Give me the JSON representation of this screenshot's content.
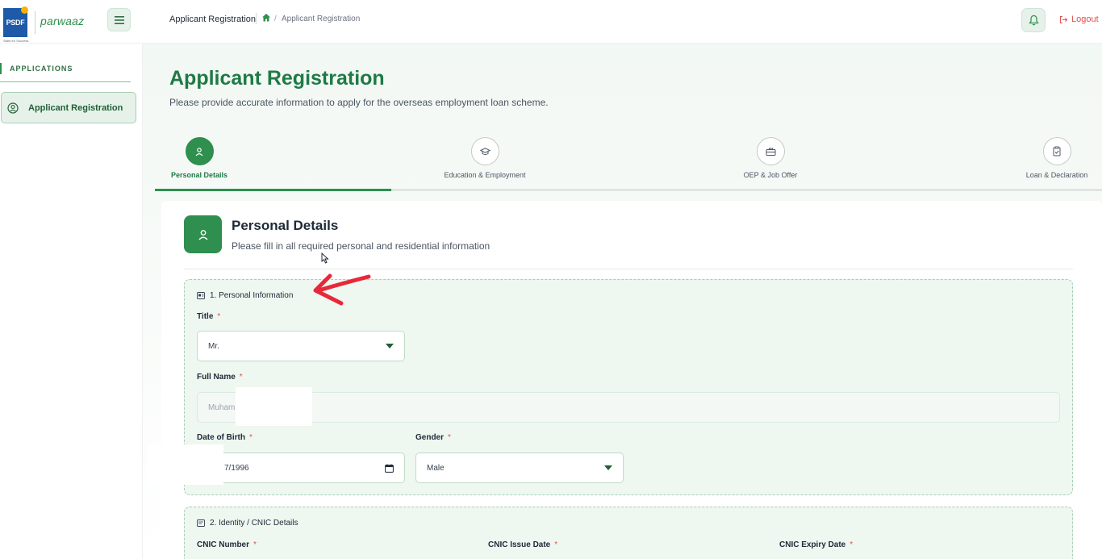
{
  "brand": {
    "logo_mark": "PSDF",
    "logo_text": "parwaaz",
    "logo_tagline": "Skills for Success",
    "primary_color": "#2f8f4e",
    "accent_color": "#1f7a45"
  },
  "header": {
    "breadcrumb_title": "Applicant Registration",
    "breadcrumb_current": "Applicant Registration",
    "breadcrumb_separator": "/",
    "logout_label": "Logout"
  },
  "sidebar": {
    "section_label": "APPLICATIONS",
    "items": [
      {
        "label": "Applicant Registration",
        "icon": "user-circle-icon",
        "active": true
      }
    ]
  },
  "page": {
    "title": "Applicant Registration",
    "subtitle": "Please provide accurate information to apply for the overseas employment loan scheme."
  },
  "steps": [
    {
      "label": "Personal Details",
      "icon": "user-icon",
      "active": true
    },
    {
      "label": "Education & Employment",
      "icon": "graduation-cap-icon",
      "active": false
    },
    {
      "label": "OEP & Job Offer",
      "icon": "briefcase-icon",
      "active": false
    },
    {
      "label": "Loan & Declaration",
      "icon": "clipboard-check-icon",
      "active": false
    }
  ],
  "card": {
    "title": "Personal Details",
    "subtitle": "Please fill in all required personal and residential information"
  },
  "section1": {
    "heading": "1. Personal Information",
    "title_label": "Title",
    "title_value": "Mr.",
    "fullname_label": "Full Name",
    "fullname_value": "Muham",
    "dob_label": "Date of Birth",
    "dob_value": "7/1996",
    "gender_label": "Gender",
    "gender_value": "Male",
    "required_mark": "*"
  },
  "section2": {
    "heading": "2. Identity / CNIC Details",
    "cnic_number_label": "CNIC Number",
    "cnic_issue_label": "CNIC Issue Date",
    "cnic_expiry_label": "CNIC Expiry Date"
  }
}
